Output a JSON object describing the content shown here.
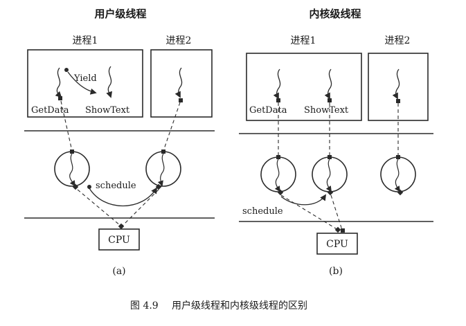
{
  "panel_a": {
    "title": "用户级线程",
    "process1": "进程1",
    "process2": "进程2",
    "yield": "Yield",
    "getdata": "GetData",
    "showtext": "ShowText",
    "schedule": "schedule",
    "cpu": "CPU",
    "label": "(a)"
  },
  "panel_b": {
    "title": "内核级线程",
    "process1": "进程1",
    "process2": "进程2",
    "getdata": "GetData",
    "showtext": "ShowText",
    "schedule": "schedule",
    "cpu": "CPU",
    "label": "(b)"
  },
  "caption": {
    "number": "图 4.9",
    "text": "用户级线程和内核级线程的区别"
  }
}
